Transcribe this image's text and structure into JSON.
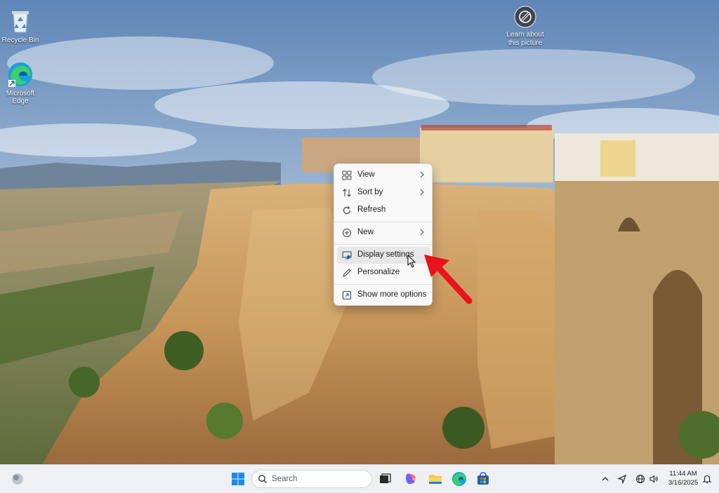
{
  "desktop": {
    "icons": [
      {
        "label": "Recycle Bin",
        "icon": "recycle-bin-icon"
      },
      {
        "label": "Microsoft Edge",
        "icon": "edge-icon"
      }
    ],
    "spotlight": {
      "line1": "Learn about",
      "line2": "this picture",
      "icon": "camera-icon"
    }
  },
  "context_menu": {
    "items": [
      {
        "label": "View",
        "icon": "grid-icon",
        "submenu": true
      },
      {
        "label": "Sort by",
        "icon": "sort-icon",
        "submenu": true
      },
      {
        "label": "Refresh",
        "icon": "refresh-icon",
        "submenu": false
      },
      {
        "label": "New",
        "icon": "plus-circle-icon",
        "submenu": true
      },
      {
        "label": "Display settings",
        "icon": "display-icon",
        "submenu": false,
        "hovered": true
      },
      {
        "label": "Personalize",
        "icon": "pen-icon",
        "submenu": false
      },
      {
        "label": "Show more options",
        "icon": "expand-icon",
        "submenu": false
      }
    ]
  },
  "annotation": {
    "arrow_color": "#e8141b"
  },
  "taskbar": {
    "search_placeholder": "Search",
    "pinned": [
      "widgets-icon",
      "start-icon",
      "task-view-icon",
      "copilot-icon",
      "file-explorer-icon",
      "edge-icon",
      "store-icon"
    ],
    "tray": [
      "chevron-up-icon",
      "location-icon",
      "network-icon",
      "volume-icon",
      "bell-icon"
    ],
    "time": "11:44 AM",
    "date": "3/16/2025"
  },
  "colors": {
    "accent": "#0067c0",
    "menu_bg": "#f8f8f8",
    "taskbar_bg": "#eef0f3"
  }
}
